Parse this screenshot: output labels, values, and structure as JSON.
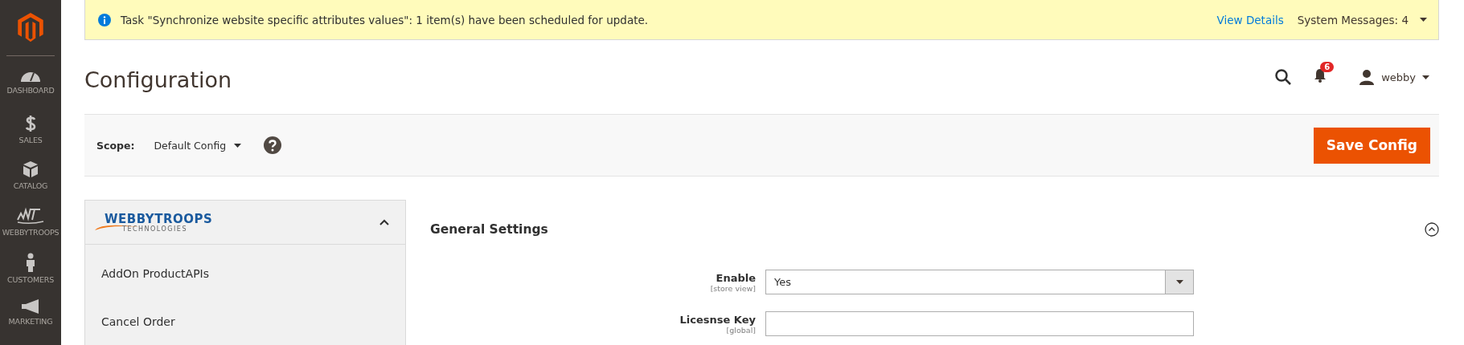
{
  "nav": [
    {
      "label": "DASHBOARD"
    },
    {
      "label": "SALES"
    },
    {
      "label": "CATALOG"
    },
    {
      "label": "WEBBYTROOPS"
    },
    {
      "label": "CUSTOMERS"
    },
    {
      "label": "MARKETING"
    }
  ],
  "message": {
    "text": "Task \"Synchronize website specific attributes values\": 1 item(s) have been scheduled for update.",
    "link": "View Details",
    "system": "System Messages: 4"
  },
  "header": {
    "title": "Configuration",
    "notifications": "6",
    "user": "webby"
  },
  "scope": {
    "label": "Scope:",
    "value": "Default Config",
    "button": "Save Config"
  },
  "side_panel": {
    "logo": "WEBBYTROOPS",
    "tagline": "TECHNOLOGIES",
    "expanded": true,
    "items": [
      {
        "label": "AddOn ProductAPIs"
      },
      {
        "label": "Cancel Order"
      }
    ]
  },
  "section": {
    "title": "General Settings",
    "expanded": true,
    "fields": [
      {
        "kind": "select",
        "label": "Enable",
        "scope": "[store view]",
        "value": "Yes"
      },
      {
        "kind": "text",
        "label": "Licesnse Key",
        "scope": "[global]"
      }
    ]
  }
}
